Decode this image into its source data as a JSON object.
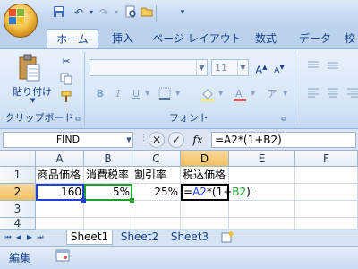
{
  "quick_access": {
    "icons": [
      "save-icon",
      "undo-icon",
      "redo-icon",
      "print-preview-icon",
      "open-icon",
      "customize-qat-icon"
    ]
  },
  "tabs": [
    "ホーム",
    "挿入",
    "ページ レイアウト",
    "数式",
    "データ",
    "校"
  ],
  "ribbon": {
    "clipboard": {
      "paste_label": "貼り付け",
      "group_label": "クリップボード"
    },
    "font": {
      "font_name": "",
      "font_size": "11",
      "group_label": "フォント",
      "bold": "B",
      "italic": "I",
      "underline": "U"
    }
  },
  "formula_bar": {
    "name_box": "FIND",
    "fx_label": "fx",
    "formula": "=A2*(1+B2)"
  },
  "grid": {
    "columns": [
      "A",
      "B",
      "C",
      "D",
      "E",
      "F"
    ],
    "rows": [
      "1",
      "2",
      "3",
      "4"
    ],
    "cells": {
      "A1": "商品価格",
      "B1": "消費税率",
      "C1": "割引率",
      "D1": "税込価格",
      "A2": "160",
      "B2": "5%",
      "C2": "25%",
      "D2_prefix": "=",
      "D2_ref1": "A2",
      "D2_mid": "*(1+",
      "D2_ref2": "B2",
      "D2_suffix": ")"
    },
    "ref_colors": {
      "a2": "#1f3fd9",
      "b2": "#1f9e2a"
    }
  },
  "sheets": [
    "Sheet1",
    "Sheet2",
    "Sheet3"
  ],
  "status": {
    "mode": "編集"
  }
}
